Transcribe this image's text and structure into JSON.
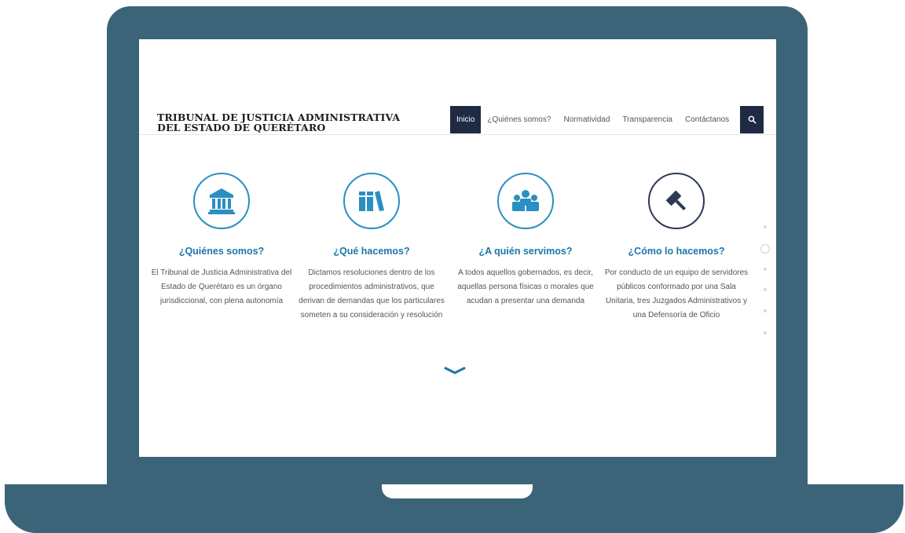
{
  "logo": {
    "line1": "TRIBUNAL DE JUSTICIA ADMINISTRATIVA",
    "line2": "DEL ESTADO DE QUERÉTARO"
  },
  "nav": {
    "items": [
      {
        "label": "Inicio",
        "active": true
      },
      {
        "label": "¿Quiénes somos?",
        "active": false
      },
      {
        "label": "Normatividad",
        "active": false
      },
      {
        "label": "Transparencia",
        "active": false
      },
      {
        "label": "Contáctanos",
        "active": false
      }
    ],
    "search_icon": "search-icon"
  },
  "features": [
    {
      "icon": "courthouse-icon",
      "title": "¿Quiénes somos?",
      "text": "El Tribunal de Justicia Administrativa del Estado de Querétaro es un órgano jurisdiccional, con plena autonomía"
    },
    {
      "icon": "books-icon",
      "title": "¿Qué hacemos?",
      "text": "Dictamos resoluciones dentro de los procedimientos administrativos, que derivan de demandas que los particulares someten a su consideración y resolución"
    },
    {
      "icon": "people-icon",
      "title": "¿A quién servimos?",
      "text": "A todos aquellos gobernados,  es decir,  aquellas persona físicas o morales que acudan a presentar una demanda"
    },
    {
      "icon": "gavel-icon",
      "title": "¿Cómo lo hacemos?",
      "text": "Por conducto de un equipo de servidores públicos conformado por una Sala Unitaria, tres Juzgados Administrativos y una Defensoría de Oficio"
    }
  ],
  "scroll_down_icon": "chevron-down-icon",
  "pager": {
    "count": 6,
    "active_index": 1
  },
  "colors": {
    "frame": "#3b6478",
    "nav_active": "#1e2b43",
    "accent": "#2a8fc1",
    "title": "#1d76a8"
  }
}
